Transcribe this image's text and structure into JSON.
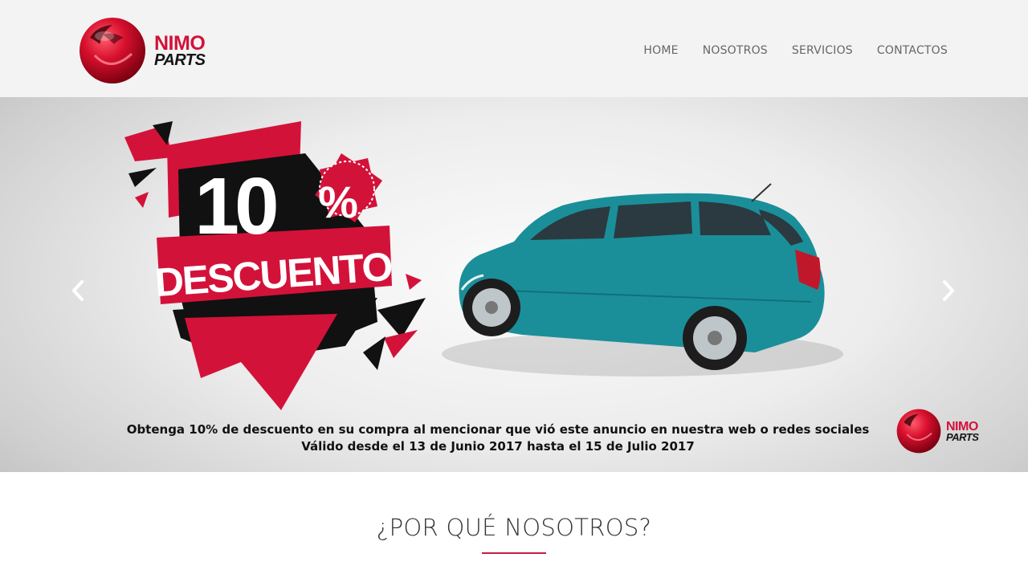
{
  "brand": {
    "name_top": "NIMO",
    "name_bottom": "PARTS"
  },
  "nav": {
    "items": [
      "HOME",
      "NOSOTROS",
      "SERVICIOS",
      "CONTACTOS"
    ]
  },
  "slider": {
    "badge_number": "10",
    "badge_percent": "%",
    "badge_word": "DESCUENTO",
    "line1": "Obtenga 10% de descuento en su compra al mencionar que vió este anuncio en nuestra web o redes sociales",
    "line2": "Válido desde el 13 de Junio 2017 hasta el 15 de Julio 2017",
    "car_color": "#1a8f9a"
  },
  "section": {
    "title": "¿POR QUÉ NOSOTROS?"
  },
  "colors": {
    "accent": "#d3123a",
    "header_bg": "#f3f3f3",
    "nav_text": "#666666"
  },
  "icons": {
    "prev": "chevron-left-icon",
    "next": "chevron-right-icon"
  }
}
